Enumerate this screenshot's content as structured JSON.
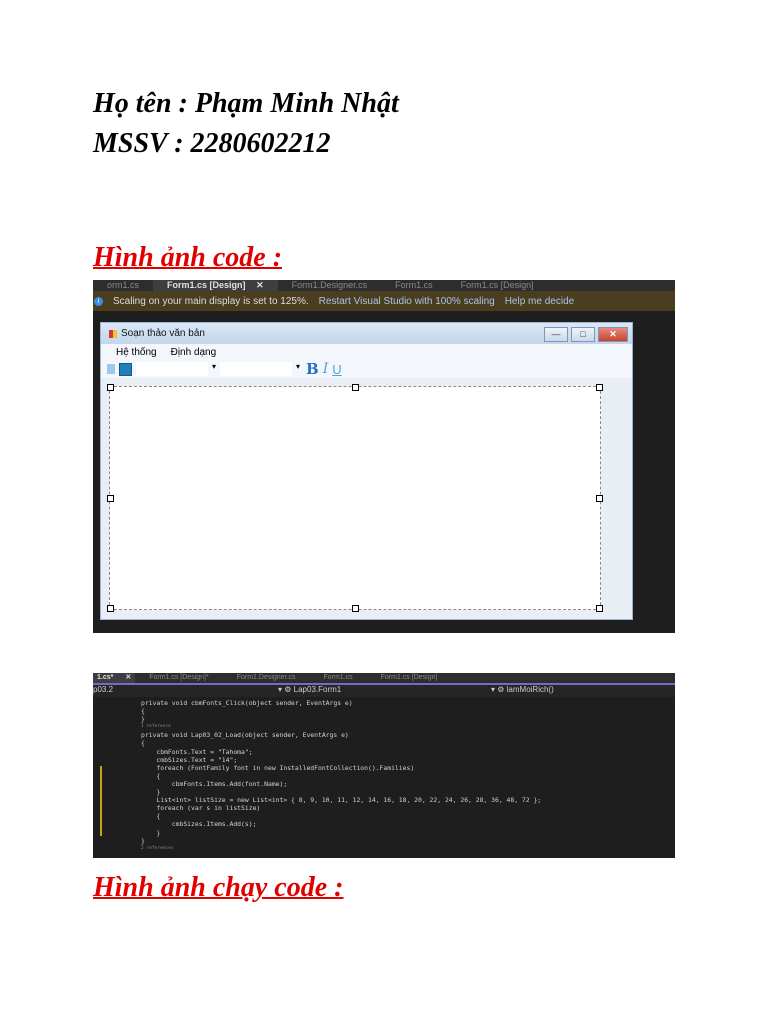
{
  "header": {
    "name_line": "Họ tên : Phạm Minh Nhật",
    "id_line": "MSSV : 2280602212"
  },
  "section_code": "Hình ảnh code : ",
  "section_run": "Hình ảnh chạy code : ",
  "screenshot1": {
    "tabs": [
      "orm1.cs",
      "Form1.cs [Design]",
      "✕",
      "Form1.Designer.cs",
      "Form1.cs",
      "Form1.cs [Design]"
    ],
    "info": {
      "message": "Scaling on your main display is set to 125%.",
      "restart": "Restart Visual Studio with 100% scaling",
      "help": "Help me decide"
    },
    "form": {
      "title": "Soạn thảo văn bản",
      "menu": [
        "Hệ thống",
        "Định dạng"
      ],
      "bold": "B",
      "italic": "I",
      "underline": "U",
      "min": "—",
      "max": "□",
      "close": "✕"
    }
  },
  "screenshot2": {
    "tabs": [
      "1.cs*",
      "✕",
      "Form1.cs [Design]*",
      "Form1.Designer.cs",
      "Form1.cs",
      "Form1.cs [Design]"
    ],
    "nav": {
      "project": "p03.2",
      "class": "Lap03.Form1",
      "member": "lamMoiRich()"
    },
    "code": [
      "private void cbmFonts_Click(object sender, EventArgs e)",
      "{",
      "",
      "}",
      "1 reference",
      "private void Lap03_02_Load(object sender, EventArgs e)",
      "{",
      "    cbmFonts.Text = \"Tahoma\";",
      "    cmbSizes.Text = \"14\";",
      "    foreach (FontFamily font in new InstalledFontCollection().Families)",
      "    {",
      "        cbmFonts.Items.Add(font.Name);",
      "    }",
      "    List<int> listSize = new List<int> { 8, 9, 10, 11, 12, 14, 16, 18, 20, 22, 24, 26, 28, 36, 48, 72 };",
      "    foreach (var s in listSize)",
      "    {",
      "        cmbSizes.Items.Add(s);",
      "    }",
      "}",
      "",
      "2 references"
    ]
  }
}
